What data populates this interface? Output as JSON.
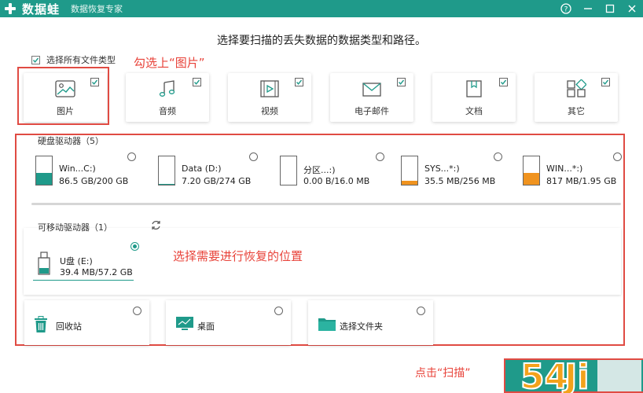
{
  "app": {
    "brand": "数据蛙",
    "subtitle": "数据恢复专家"
  },
  "window_controls": [
    "help-icon",
    "minimize-icon",
    "maximize-icon",
    "close-icon"
  ],
  "heading": "选择要扫描的丢失数据的数据类型和路径。",
  "select_all": {
    "label": "选择所有文件类型",
    "checked": true
  },
  "annotations": {
    "pick_image": "勾选上“图片”",
    "pick_location": "选择需要进行恢复的位置",
    "click_scan": "点击“扫描”"
  },
  "file_types": [
    {
      "label": "图片",
      "icon": "image-icon",
      "checked": true
    },
    {
      "label": "音频",
      "icon": "music-icon",
      "checked": true
    },
    {
      "label": "视频",
      "icon": "video-icon",
      "checked": true
    },
    {
      "label": "电子邮件",
      "icon": "mail-icon",
      "checked": true
    },
    {
      "label": "文档",
      "icon": "document-icon",
      "checked": true
    },
    {
      "label": "其它",
      "icon": "other-icon",
      "checked": true
    }
  ],
  "hard_drives": {
    "label": "硬盘驱动器（5）",
    "items": [
      {
        "name": "Win...C:)",
        "size": "86.5 GB/200 GB",
        "used": 0.43,
        "color": "#1f9a8a"
      },
      {
        "name": "Data (D:)",
        "size": "7.20 GB/274 GB",
        "used": 0.03,
        "color": "#1f9a8a"
      },
      {
        "name": "分区...:)",
        "size": "0.00  B/16.0 MB",
        "used": 0.0,
        "color": "#1f9a8a"
      },
      {
        "name": "SYS...*:)",
        "size": "35.5 MB/256 MB",
        "used": 0.14,
        "color": "#f0931f"
      },
      {
        "name": "WIN...*:)",
        "size": "817 MB/1.95 GB",
        "used": 0.42,
        "color": "#f0931f"
      }
    ]
  },
  "removable": {
    "label": "可移动驱动器（1）",
    "refresh_icon": "refresh-icon",
    "items": [
      {
        "name": "U盘 (E:)",
        "size": "39.4 MB/57.2 GB",
        "selected": true
      }
    ]
  },
  "locations": [
    {
      "label": "回收站",
      "icon": "trash-icon"
    },
    {
      "label": "桌面",
      "icon": "desktop-icon"
    },
    {
      "label": "选择文件夹",
      "icon": "folder-icon"
    }
  ],
  "colors": {
    "accent": "#1f9a8a",
    "annotation": "#e04b43",
    "warning": "#f0931f"
  }
}
